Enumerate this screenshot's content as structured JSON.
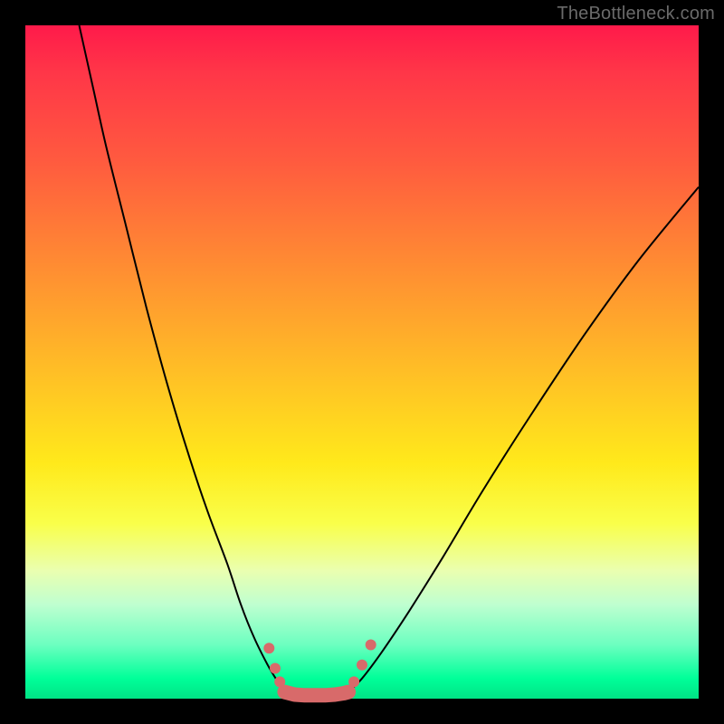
{
  "watermark": "TheBottleneck.com",
  "chart_data": {
    "type": "line",
    "title": "",
    "xlabel": "",
    "ylabel": "",
    "xlim": [
      0,
      100
    ],
    "ylim": [
      0,
      100
    ],
    "grid": false,
    "legend": false,
    "series": [
      {
        "name": "left-curve",
        "x": [
          8,
          10,
          12,
          15,
          18,
          21,
          24,
          27,
          30,
          32,
          34,
          36,
          37.5,
          38.5
        ],
        "values": [
          100,
          91,
          82,
          70,
          58,
          47,
          37,
          28,
          20,
          14,
          9,
          5,
          2.5,
          1
        ]
      },
      {
        "name": "right-curve",
        "x": [
          48,
          50,
          53,
          57,
          62,
          68,
          75,
          83,
          91,
          100
        ],
        "values": [
          1,
          3,
          7,
          13,
          21,
          31,
          42,
          54,
          65,
          76
        ]
      },
      {
        "name": "valley-floor-band",
        "kind": "scatter-segment",
        "x": [
          38.5,
          40,
          41.5,
          43,
          44.5,
          46,
          47.3,
          48
        ],
        "values": [
          1,
          0.6,
          0.5,
          0.5,
          0.5,
          0.6,
          0.8,
          1
        ],
        "marker_color": "#d86a6a",
        "marker_size": 10
      },
      {
        "name": "left-wall-markers",
        "kind": "scatter",
        "points": [
          {
            "x": 36.2,
            "y": 7.5
          },
          {
            "x": 37.1,
            "y": 4.5
          },
          {
            "x": 37.8,
            "y": 2.5
          }
        ],
        "marker_color": "#d86a6a",
        "marker_size": 9
      },
      {
        "name": "right-wall-markers",
        "kind": "scatter",
        "points": [
          {
            "x": 48.8,
            "y": 2.5
          },
          {
            "x": 50.0,
            "y": 5.0
          },
          {
            "x": 51.3,
            "y": 8.0
          }
        ],
        "marker_color": "#d86a6a",
        "marker_size": 9
      }
    ]
  }
}
